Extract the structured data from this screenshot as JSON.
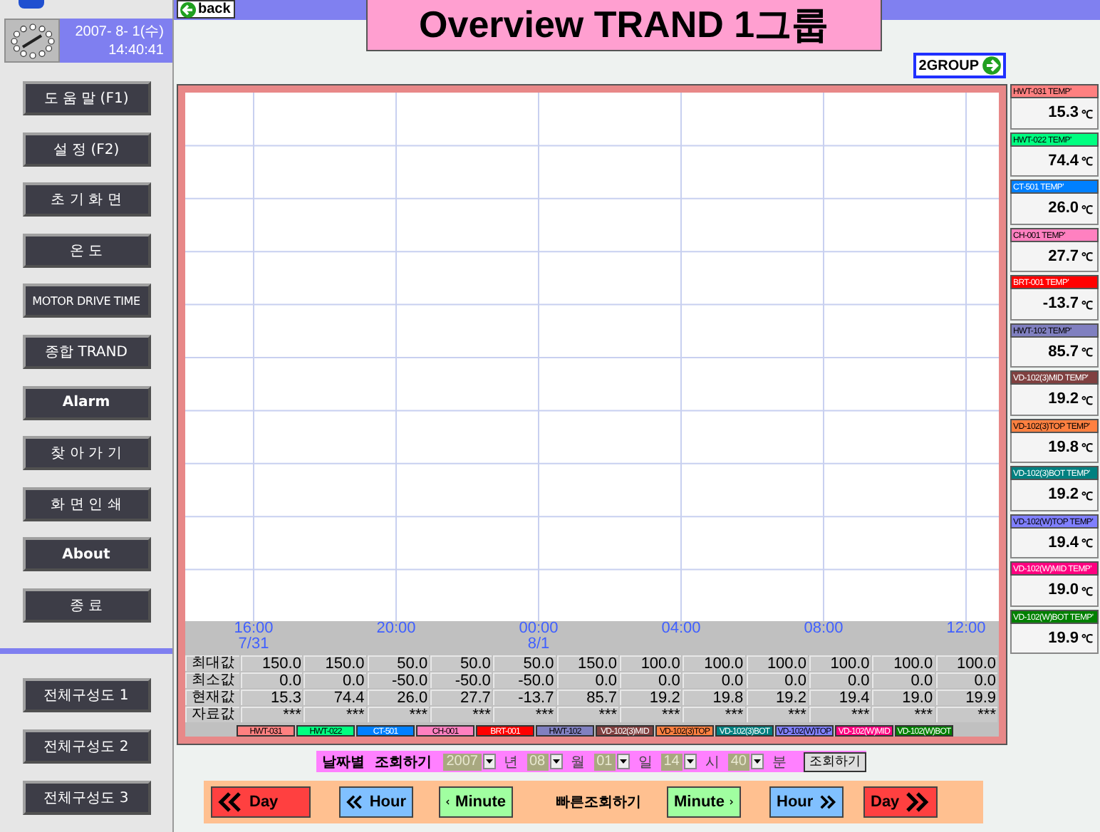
{
  "sidebar": {
    "clock": {
      "date": "2007- 8- 1(수)",
      "time": "14:40:41"
    },
    "menu": [
      {
        "label": "도 움 말 (F1)",
        "bold": false
      },
      {
        "label": "설 정 (F2)",
        "bold": false
      },
      {
        "label": "초 기 화 면",
        "bold": false
      },
      {
        "label": "온    도",
        "bold": false
      },
      {
        "label": "MOTOR DRIVE TIME",
        "bold": false
      },
      {
        "label": "종합 TRAND",
        "bold": false
      },
      {
        "label": "Alarm",
        "bold": true
      },
      {
        "label": "찾 아 가 기",
        "bold": false
      },
      {
        "label": "화 면 인 쇄",
        "bold": false
      },
      {
        "label": "About",
        "bold": true
      },
      {
        "label": "종    료",
        "bold": false
      }
    ],
    "views": [
      {
        "label": "전체구성도 1"
      },
      {
        "label": "전체구성도 2"
      },
      {
        "label": "전체구성도 3"
      }
    ]
  },
  "header": {
    "back": "back",
    "title": "Overview TRAND 1그룹",
    "next": "2GROUP"
  },
  "trend": {
    "time_labels": [
      {
        "time": "16:00",
        "date": "7/31"
      },
      {
        "time": "20:00"
      },
      {
        "time": "00:00",
        "date": "8/1"
      },
      {
        "time": "04:00"
      },
      {
        "time": "08:00"
      },
      {
        "time": "12:00"
      }
    ],
    "row_labels": [
      "최대값",
      "최소값",
      "현재값",
      "자료값"
    ],
    "tags": [
      {
        "name": "HWT-031",
        "color": "#ff8080",
        "max": "150.0",
        "min": "0.0",
        "current": "15.3",
        "data": "***"
      },
      {
        "name": "HWT-022",
        "color": "#00ff80",
        "max": "150.0",
        "min": "0.0",
        "current": "74.4",
        "data": "***"
      },
      {
        "name": "CT-501",
        "color": "#0080ff",
        "max": "50.0",
        "min": "-50.0",
        "current": "26.0",
        "data": "***"
      },
      {
        "name": "CH-001",
        "color": "#ff80c0",
        "max": "50.0",
        "min": "-50.0",
        "current": "27.7",
        "data": "***"
      },
      {
        "name": "BRT-001",
        "color": "#ff0000",
        "max": "50.0",
        "min": "-50.0",
        "current": "-13.7",
        "data": "***"
      },
      {
        "name": "HWT-102",
        "color": "#8080c0",
        "max": "150.0",
        "min": "0.0",
        "current": "85.7",
        "data": "***"
      },
      {
        "name": "VD-102(3)MID",
        "color": "#804040",
        "max": "100.0",
        "min": "0.0",
        "current": "19.2",
        "data": "***"
      },
      {
        "name": "VD-102(3)TOP",
        "color": "#ff8040",
        "max": "100.0",
        "min": "0.0",
        "current": "19.8",
        "data": "***"
      },
      {
        "name": "VD-102(3)BOT",
        "color": "#008080",
        "max": "100.0",
        "min": "0.0",
        "current": "19.2",
        "data": "***"
      },
      {
        "name": "VD-102(W)TOP",
        "color": "#8080ff",
        "max": "100.0",
        "min": "0.0",
        "current": "19.4",
        "data": "***"
      },
      {
        "name": "VD-102(W)MID",
        "color": "#ff0080",
        "max": "100.0",
        "min": "0.0",
        "current": "19.0",
        "data": "***"
      },
      {
        "name": "VD-102(W)BOT",
        "color": "#008000",
        "max": "100.0",
        "min": "0.0",
        "current": "19.9",
        "data": "***"
      }
    ]
  },
  "cards": [
    {
      "label": "HWT-031 TEMP'",
      "color": "#ff8080",
      "reading": "15.3",
      "unit": "℃"
    },
    {
      "label": "HWT-022 TEMP'",
      "color": "#00ff80",
      "reading": "74.4",
      "unit": "℃"
    },
    {
      "label": "CT-501 TEMP'",
      "color": "#0080ff",
      "reading": "26.0",
      "unit": "℃"
    },
    {
      "label": "CH-001 TEMP'",
      "color": "#ff80c0",
      "reading": "27.7",
      "unit": "℃"
    },
    {
      "label": "BRT-001 TEMP'",
      "color": "#ff0000",
      "reading": "-13.7",
      "unit": "℃"
    },
    {
      "label": "HWT-102 TEMP'",
      "color": "#8080c0",
      "reading": "85.7",
      "unit": "℃"
    },
    {
      "label": "VD-102(3)MID TEMP'",
      "color": "#804040",
      "reading": "19.2",
      "unit": "℃"
    },
    {
      "label": "VD-102(3)TOP TEMP'",
      "color": "#ff8040",
      "reading": "19.8",
      "unit": "℃"
    },
    {
      "label": "VD-102(3)BOT TEMP'",
      "color": "#008080",
      "reading": "19.2",
      "unit": "℃"
    },
    {
      "label": "VD-102(W)TOP TEMP'",
      "color": "#8080ff",
      "reading": "19.4",
      "unit": "℃"
    },
    {
      "label": "VD-102(W)MID TEMP'",
      "color": "#ff0080",
      "reading": "19.0",
      "unit": "℃"
    },
    {
      "label": "VD-102(W)BOT TEMP'",
      "color": "#008000",
      "reading": "19.9",
      "unit": "℃"
    }
  ],
  "date_query": {
    "label": "날짜별  조회하기",
    "fields": [
      {
        "value": "2007",
        "unit": "년"
      },
      {
        "value": "08",
        "unit": "월"
      },
      {
        "value": "01",
        "unit": "일"
      },
      {
        "value": "14",
        "unit": "시"
      },
      {
        "value": "40",
        "unit": "분"
      }
    ],
    "button": "조회하기"
  },
  "quick_query": {
    "label": "빠른조회하기",
    "buttons": [
      {
        "label": "Day",
        "kind": "rewind",
        "color": "#ff4040"
      },
      {
        "label": "Hour",
        "kind": "rewind",
        "color": "#80c0ff"
      },
      {
        "label": "Minute",
        "kind": "back",
        "color": "#a0ffa0"
      },
      {
        "label": "Minute",
        "kind": "forward",
        "color": "#a0ffa0"
      },
      {
        "label": "Hour",
        "kind": "fastforward",
        "color": "#80c0ff"
      },
      {
        "label": "Day",
        "kind": "fastforward",
        "color": "#ff4040"
      }
    ]
  }
}
